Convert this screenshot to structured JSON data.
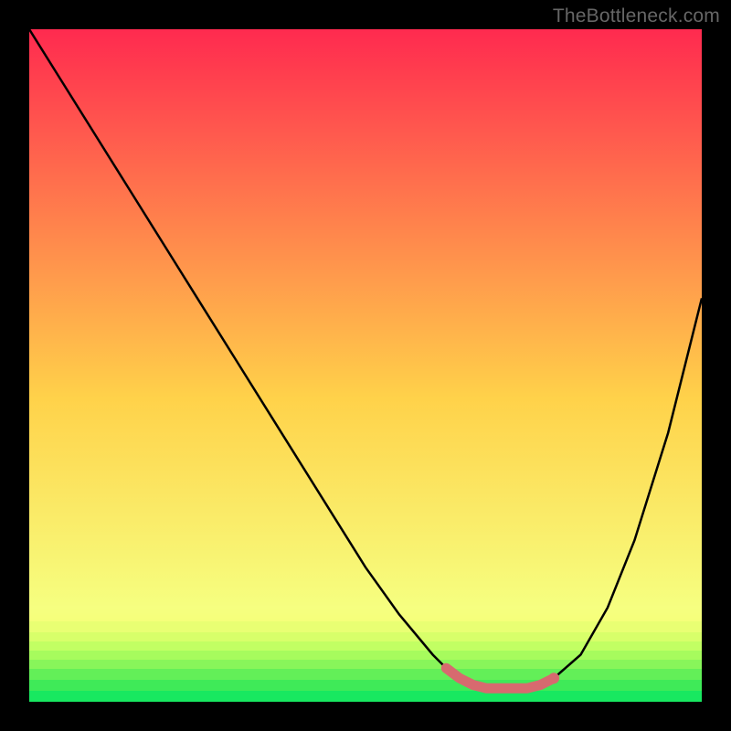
{
  "watermark": "TheBottleneck.com",
  "colors": {
    "frame_bg": "#000000",
    "gradient_top": "#ff2a4f",
    "gradient_mid": "#ffd24a",
    "gradient_low": "#f6ff80",
    "gradient_band_yellow": "#f4ff6e",
    "gradient_bottom": "#18e860",
    "curve": "#000000",
    "marker_fill": "#d76a6f",
    "marker_stroke": "#d76a6f"
  },
  "chart_data": {
    "type": "line",
    "title": "",
    "xlabel": "",
    "ylabel": "",
    "xlim": [
      0,
      100
    ],
    "ylim": [
      0,
      100
    ],
    "grid": false,
    "legend": false,
    "series": [
      {
        "name": "bottleneck-curve",
        "x": [
          0,
          5,
          10,
          15,
          20,
          25,
          30,
          35,
          40,
          45,
          50,
          55,
          60,
          62,
          64,
          66,
          68,
          70,
          72,
          74,
          76,
          78,
          82,
          86,
          90,
          95,
          100
        ],
        "y": [
          100,
          92,
          84,
          76,
          68,
          60,
          52,
          44,
          36,
          28,
          20,
          13,
          7,
          5,
          3.5,
          2.5,
          2,
          2,
          2,
          2,
          2.5,
          3.5,
          7,
          14,
          24,
          40,
          60
        ]
      }
    ],
    "markers": {
      "name": "optimal-zone",
      "x": [
        62,
        64,
        66,
        68,
        70,
        72,
        74,
        76,
        78
      ],
      "y": [
        5,
        3.5,
        2.5,
        2,
        2,
        2,
        2,
        2.5,
        3.5
      ]
    }
  }
}
